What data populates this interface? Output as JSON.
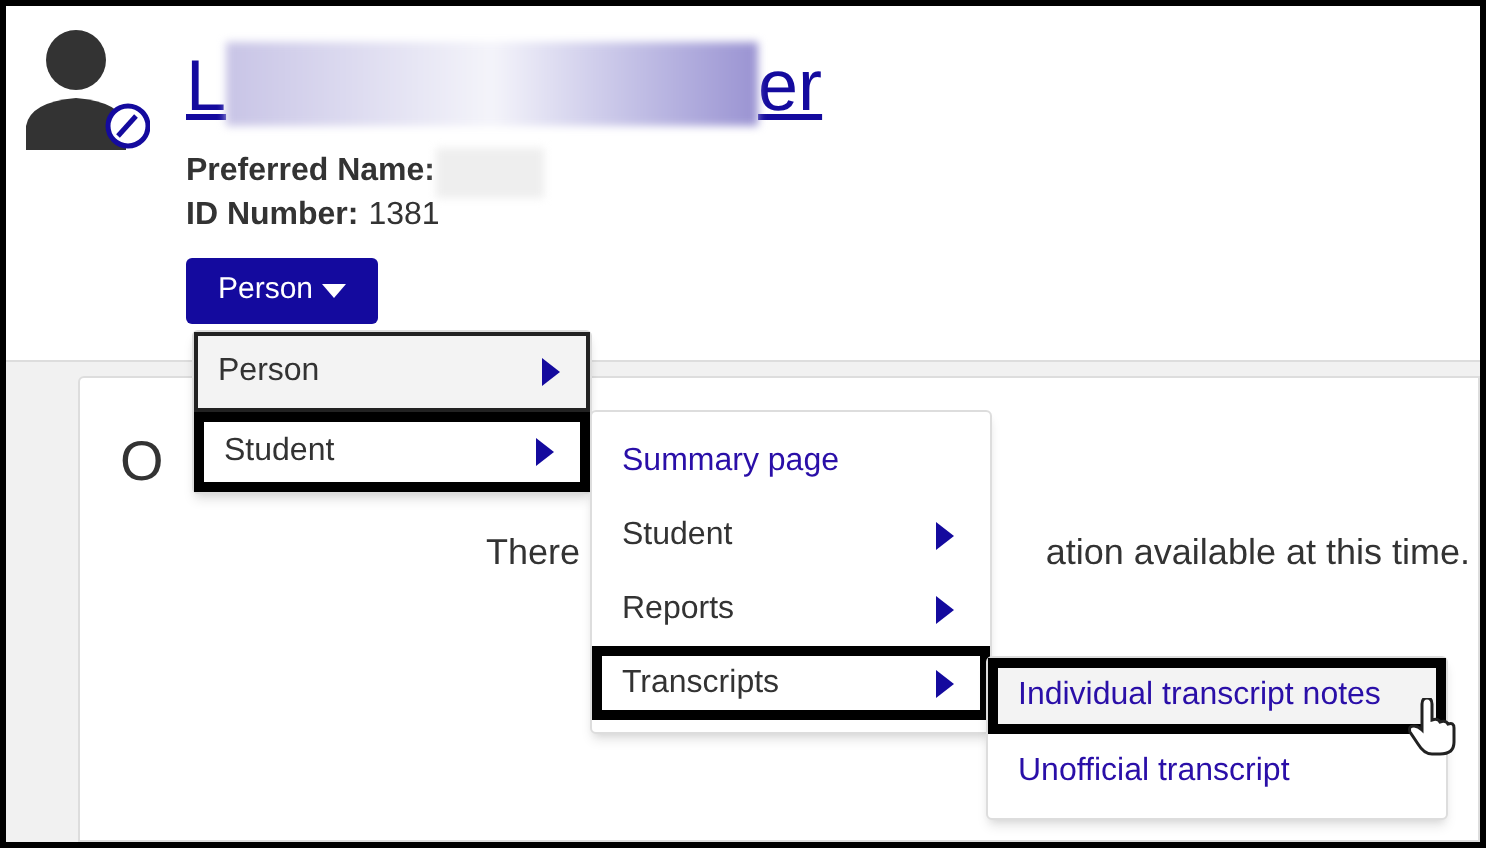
{
  "profile": {
    "name_start": "L",
    "name_end": "er",
    "name_redacted": true,
    "preferred_name_label": "Preferred Name:",
    "id_label": "ID Number:",
    "id_value": "1381"
  },
  "person_button": {
    "label": "Person"
  },
  "overview": {
    "heading": "O",
    "message_start": "There",
    "message_end": "ation available at this time."
  },
  "menus": [
    {
      "items": [
        {
          "label": "Person",
          "kind": "submenu",
          "selected": false,
          "focused": true
        },
        {
          "label": "Student",
          "kind": "submenu",
          "selected": true,
          "focused": false
        }
      ]
    },
    {
      "items": [
        {
          "label": "Summary page",
          "kind": "link",
          "selected": false,
          "focused": false
        },
        {
          "label": "Student",
          "kind": "submenu",
          "selected": false,
          "focused": false
        },
        {
          "label": "Reports",
          "kind": "submenu",
          "selected": false,
          "focused": false
        },
        {
          "label": "Transcripts",
          "kind": "submenu",
          "selected": true,
          "focused": false
        }
      ]
    },
    {
      "items": [
        {
          "label": "Individual transcript notes",
          "kind": "link",
          "selected": true,
          "focused": true
        },
        {
          "label": "Unofficial transcript",
          "kind": "link",
          "selected": false,
          "focused": false
        }
      ]
    }
  ]
}
